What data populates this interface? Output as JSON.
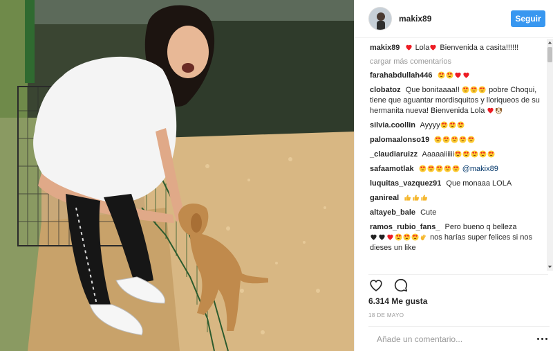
{
  "post": {
    "username": "makix89",
    "follow_label": "Seguir",
    "photo_alt": "Mujer sonriendo con un cachorro",
    "caption": {
      "user": "makix89",
      "text_a": "Lola",
      "text_b": "Bienvenida a casita!!!!!!"
    },
    "load_more": "cargar más comentarios",
    "comments": [
      {
        "user": "farahabdullah446",
        "text": ""
      },
      {
        "user": "clobatoz",
        "text_a": "Que bonitaaaa!!",
        "text_b": "pobre Choqui, tiene que aguantar mordisquitos y lloriqueos de su hermanita nueva! Bienvenida Lola"
      },
      {
        "user": "silvia.coollin",
        "text": "Ayyyy"
      },
      {
        "user": "palomaalonso19",
        "text": ""
      },
      {
        "user": "_claudiaruizz",
        "text": "Aaaaaiiiiii"
      },
      {
        "user": "safaamotlak",
        "text": "",
        "mention": "@makix89"
      },
      {
        "user": "luquitas_vazquez91",
        "text": "Que monaaa LOLA"
      },
      {
        "user": "ganireal",
        "text": ""
      },
      {
        "user": "altayeb_bale",
        "text": "Cute"
      },
      {
        "user": "ramos_rubio_fans_",
        "text_a": "Pero bueno q belleza",
        "text_b": "nos harías super felices si nos dieses un like"
      }
    ],
    "likes": "6.314 Me gusta",
    "date": "18 DE MAYO",
    "comment_placeholder": "Añade un comentario...",
    "icons": [
      "heart-icon",
      "comment-icon",
      "more-icon"
    ],
    "colors": {
      "accent": "#3897f0",
      "muted": "#999999",
      "heart": "#ed1c24"
    }
  }
}
